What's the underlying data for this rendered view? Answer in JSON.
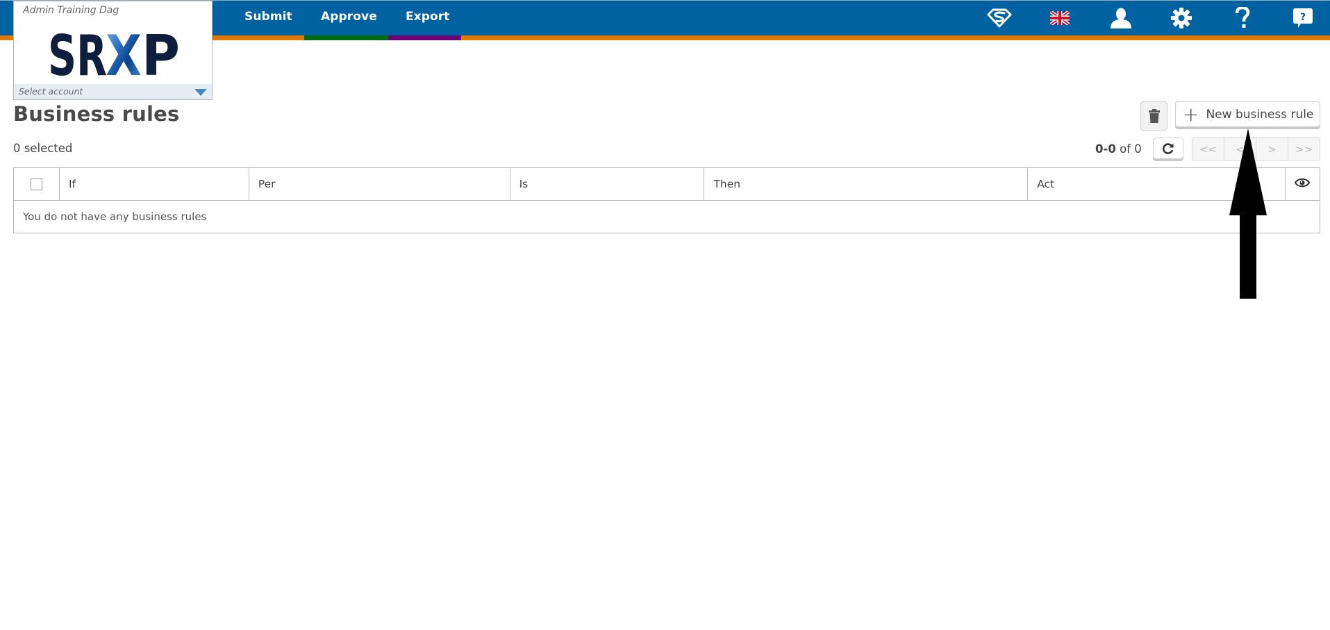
{
  "header": {
    "nav": [
      {
        "label": "Submit",
        "color": "#e07800"
      },
      {
        "label": "Approve",
        "color": "#006a14"
      },
      {
        "label": "Export",
        "color": "#6d0072"
      }
    ],
    "icons": [
      "superman-icon",
      "uk-flag-icon",
      "user-icon",
      "gear-icon",
      "help-icon",
      "feedback-icon"
    ],
    "brand_color": "#0062a0",
    "accent_color": "#e07800"
  },
  "account": {
    "name": "Admin Training Dag",
    "logo_text": "SRXP",
    "select_placeholder": "Select account"
  },
  "page": {
    "title": "Business rules",
    "selected_count": "0 selected",
    "new_button_label": "New business rule"
  },
  "pagination": {
    "range": "0-0",
    "of_label": "of",
    "total": "0",
    "buttons": [
      "<<",
      "<",
      ">",
      ">>"
    ]
  },
  "table": {
    "columns": [
      "If",
      "Per",
      "Is",
      "Then",
      "Act"
    ],
    "empty_message": "You do not have any business rules"
  }
}
